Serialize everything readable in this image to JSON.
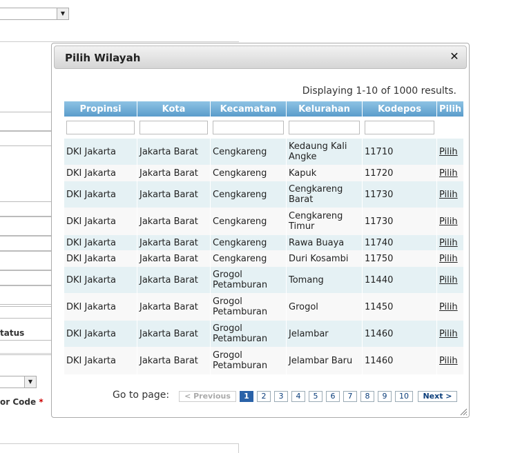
{
  "background": {
    "labels": {
      "status": "tatus",
      "code": "or Code",
      "required_mark": "*"
    }
  },
  "dialog": {
    "title": "Pilih Wilayah",
    "close_icon": "close-icon",
    "summary": "Displaying 1-10 of 1000 results.",
    "columns": [
      "Propinsi",
      "Kota",
      "Kecamatan",
      "Kelurahan",
      "Kodepos",
      "Pilih"
    ],
    "rows": [
      {
        "propinsi": "DKI Jakarta",
        "kota": "Jakarta Barat",
        "kecamatan": "Cengkareng",
        "kelurahan": "Kedaung Kali Angke",
        "kodepos": "11710",
        "pilih": "Pilih"
      },
      {
        "propinsi": "DKI Jakarta",
        "kota": "Jakarta Barat",
        "kecamatan": "Cengkareng",
        "kelurahan": "Kapuk",
        "kodepos": "11720",
        "pilih": "Pilih"
      },
      {
        "propinsi": "DKI Jakarta",
        "kota": "Jakarta Barat",
        "kecamatan": "Cengkareng",
        "kelurahan": "Cengkareng Barat",
        "kodepos": "11730",
        "pilih": "Pilih"
      },
      {
        "propinsi": "DKI Jakarta",
        "kota": "Jakarta Barat",
        "kecamatan": "Cengkareng",
        "kelurahan": "Cengkareng Timur",
        "kodepos": "11730",
        "pilih": "Pilih"
      },
      {
        "propinsi": "DKI Jakarta",
        "kota": "Jakarta Barat",
        "kecamatan": "Cengkareng",
        "kelurahan": "Rawa Buaya",
        "kodepos": "11740",
        "pilih": "Pilih"
      },
      {
        "propinsi": "DKI Jakarta",
        "kota": "Jakarta Barat",
        "kecamatan": "Cengkareng",
        "kelurahan": "Duri Kosambi",
        "kodepos": "11750",
        "pilih": "Pilih"
      },
      {
        "propinsi": "DKI Jakarta",
        "kota": "Jakarta Barat",
        "kecamatan": "Grogol Petamburan",
        "kelurahan": "Tomang",
        "kodepos": "11440",
        "pilih": "Pilih"
      },
      {
        "propinsi": "DKI Jakarta",
        "kota": "Jakarta Barat",
        "kecamatan": "Grogol Petamburan",
        "kelurahan": "Grogol",
        "kodepos": "11450",
        "pilih": "Pilih"
      },
      {
        "propinsi": "DKI Jakarta",
        "kota": "Jakarta Barat",
        "kecamatan": "Grogol Petamburan",
        "kelurahan": "Jelambar",
        "kodepos": "11460",
        "pilih": "Pilih"
      },
      {
        "propinsi": "DKI Jakarta",
        "kota": "Jakarta Barat",
        "kecamatan": "Grogol Petamburan",
        "kelurahan": "Jelambar Baru",
        "kodepos": "11460",
        "pilih": "Pilih"
      }
    ],
    "pager": {
      "label": "Go to page:",
      "prev": "< Previous",
      "pages": [
        "1",
        "2",
        "3",
        "4",
        "5",
        "6",
        "7",
        "8",
        "9",
        "10"
      ],
      "current": "1",
      "next": "Next >"
    }
  }
}
